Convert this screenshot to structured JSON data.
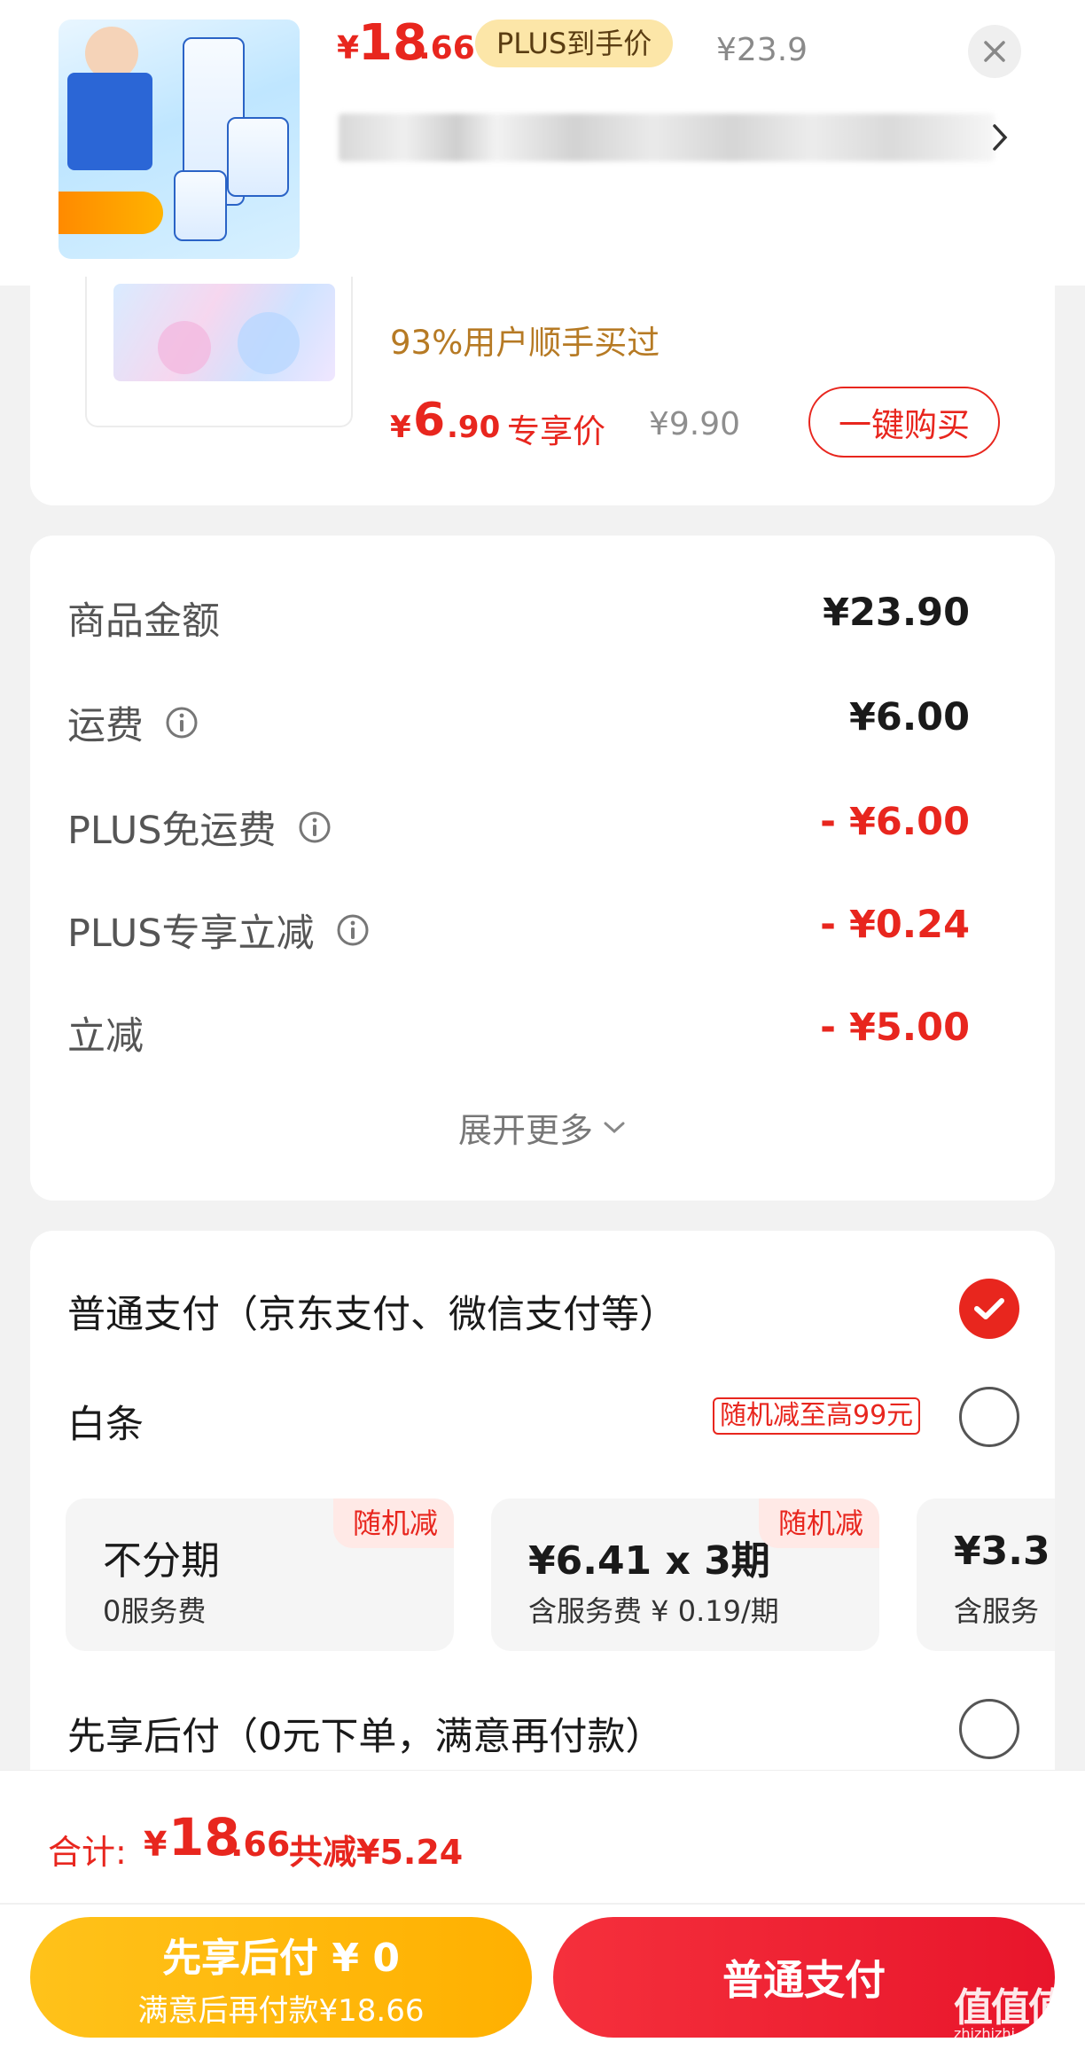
{
  "colors": {
    "accent": "#e8261e",
    "plus_tag_bg": "#fce6a8",
    "later_button": "#ffb000",
    "pay_button": "#e8152b"
  },
  "header": {
    "price_symbol": "¥",
    "price_int": "18",
    "price_dec": ".66",
    "plus_tag": "PLUS到手价",
    "original_price": "¥23.9",
    "close_icon": "close-icon",
    "title_chevron_icon": "chevron-right-icon"
  },
  "recommend": {
    "subtitle": "93%用户顺手买过",
    "price_symbol": "¥",
    "price_int": "6",
    "price_dec": ".90",
    "price_tag": "专享价",
    "original_price": "¥9.90",
    "buy_button": "一键购买"
  },
  "summary": {
    "rows": [
      {
        "label": "商品金额",
        "value": "¥23.90"
      },
      {
        "label": "运费",
        "value": "¥6.00"
      },
      {
        "label": "PLUS免运费",
        "value": "- ¥6.00"
      },
      {
        "label": "PLUS专享立减",
        "value": "- ¥0.24"
      },
      {
        "label": "立减",
        "value": "- ¥5.00"
      }
    ],
    "expand_more": "展开更多"
  },
  "payment": {
    "normal_label": "普通支付（京东支付、微信支付等）",
    "baitiao_label": "白条",
    "baitiao_promo": "随机减至高99元",
    "plans": [
      {
        "title": "不分期",
        "fee": "0服务费",
        "tag": "随机减"
      },
      {
        "title": "¥6.41 x 3期",
        "fee": "含服务费 ¥ 0.19/期",
        "tag": "随机减"
      },
      {
        "title": "¥3.3",
        "fee": "含服务"
      }
    ],
    "pay_later_label": "先享后付（0元下单，满意再付款）"
  },
  "footer": {
    "total_label": "合计:",
    "total_symbol": "¥",
    "total_int": "18",
    "total_dec": ".66",
    "total_saving": "共减¥5.24",
    "later_button_line1": "先享后付 ¥ 0",
    "later_button_line2": "满意后再付款¥18.66",
    "pay_button": "普通支付"
  },
  "watermark": {
    "text": "值值值",
    "url": "zhizhizhi.com"
  }
}
